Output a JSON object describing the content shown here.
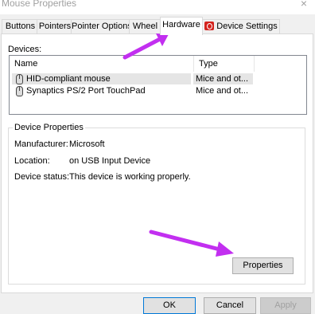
{
  "window": {
    "title": "Mouse Properties",
    "close_glyph": "×"
  },
  "tabs": [
    {
      "label": "Buttons"
    },
    {
      "label": "Pointers"
    },
    {
      "label": "Pointer Options"
    },
    {
      "label": "Wheel"
    },
    {
      "label": "Hardware",
      "active": true
    },
    {
      "label": "Device Settings"
    }
  ],
  "devices": {
    "label": "Devices:",
    "columns": [
      "Name",
      "Type"
    ],
    "rows": [
      {
        "name": "HID-compliant mouse",
        "type": "Mice and ot...",
        "selected": true
      },
      {
        "name": "Synaptics PS/2 Port TouchPad",
        "type": "Mice and ot...",
        "selected": false
      }
    ]
  },
  "device_properties": {
    "legend": "Device Properties",
    "manufacturer_label": "Manufacturer:",
    "manufacturer_value": "Microsoft",
    "location_label": "Location:",
    "location_value": "on USB Input Device",
    "status_label": "Device status:",
    "status_value": "This device is working properly.",
    "properties_button": "Properties"
  },
  "footer": {
    "ok": "OK",
    "cancel": "Cancel",
    "apply": "Apply"
  },
  "colors": {
    "annotation_arrow": "#c22ff0",
    "device_settings_icon": "#d4231e"
  }
}
